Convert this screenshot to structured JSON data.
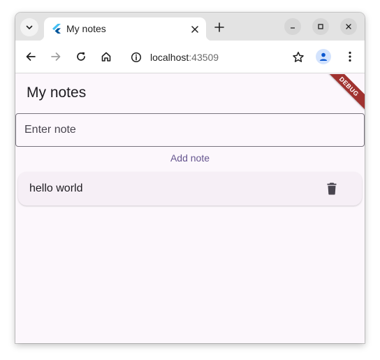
{
  "browser": {
    "tab": {
      "title": "My notes",
      "favicon": "flutter-icon"
    },
    "address": {
      "host": "localhost",
      "port": ":43509"
    }
  },
  "app": {
    "title": "My notes",
    "debug_banner": "DEBUG",
    "note_input": {
      "placeholder": "Enter note",
      "value": ""
    },
    "add_button_label": "Add note",
    "notes": [
      {
        "text": "hello world",
        "action_icon": "delete-icon"
      }
    ]
  },
  "colors": {
    "accent": "#65558f",
    "app_background": "#fcf7fc",
    "card_background": "#f6eff6",
    "debug_banner": "#a0322f"
  }
}
